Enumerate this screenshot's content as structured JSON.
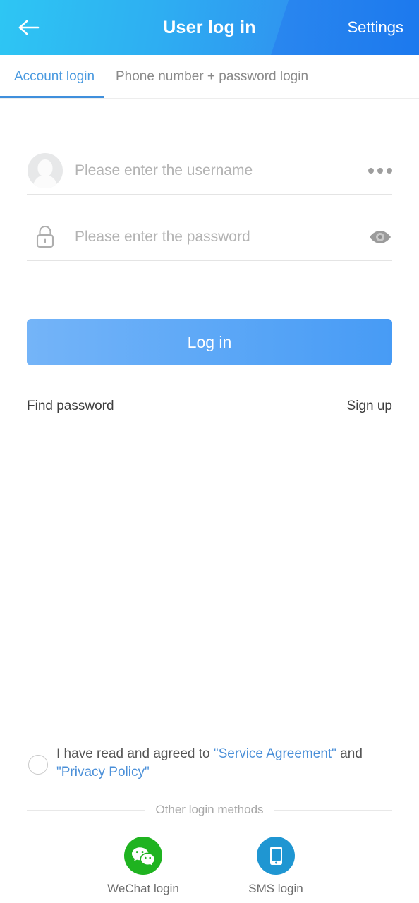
{
  "header": {
    "title": "User log in",
    "back_icon": "back-arrow-icon",
    "action_label": "Settings",
    "gradient_start": "#2ec6f3",
    "gradient_end": "#1c79ee"
  },
  "tabs": [
    {
      "label": "Account login",
      "active": true,
      "color": "#4a9ae0"
    },
    {
      "label": "Phone number + password login",
      "active": false,
      "color": "#8a8a8a"
    }
  ],
  "tab_underline_color": "#3f8fdc",
  "form": {
    "username": {
      "value": "",
      "placeholder": "Please enter the username",
      "leading_icon": "user-avatar-icon",
      "trailing_icon": "more-options-icon"
    },
    "password": {
      "value": "",
      "placeholder": "Please enter the password",
      "leading_icon": "lock-icon",
      "trailing_icon": "eye-icon"
    }
  },
  "login_button": {
    "label": "Log in",
    "gradient_start": "#74b4f8",
    "gradient_end": "#479bf5"
  },
  "helpers": {
    "find_password": "Find password",
    "sign_up": "Sign up"
  },
  "agreement": {
    "checked": false,
    "prefix": "I have read and agreed to ",
    "link_service": "\"Service Agreement\"",
    "conjunction": " and ",
    "link_privacy": "\"Privacy Policy\"",
    "link_color": "#4a8fd8"
  },
  "other_methods": {
    "divider_label": "Other login methods",
    "items": [
      {
        "label": "WeChat login",
        "icon": "wechat-icon",
        "color": "#1fb320"
      },
      {
        "label": "SMS login",
        "icon": "sms-phone-icon",
        "color": "#1f96d2"
      }
    ]
  }
}
